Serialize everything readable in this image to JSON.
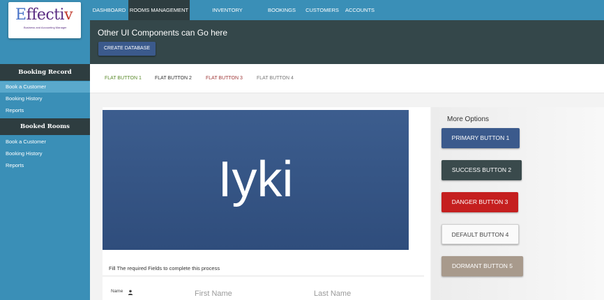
{
  "brand": {
    "logo_first": "E",
    "logo_mid": "ffecti",
    "logo_last": "v",
    "tagline": "Business and Accounting Manager"
  },
  "nav": {
    "items": [
      {
        "label": "DASHBOARD"
      },
      {
        "label": "ROOMS MANAGEMENT"
      },
      {
        "label": "INVENTORY MANAGEMENT"
      },
      {
        "label": "BOOKINGS"
      },
      {
        "label": "CUSTOMERS"
      },
      {
        "label": "ACCOUNTS"
      }
    ],
    "active": "ROOMS MANAGEMENT"
  },
  "header": {
    "title": "Other UI Components can Go here",
    "create_label": "CREATE DATABASE"
  },
  "sidebar": {
    "section1_title": "Booking Record",
    "section1_items": [
      "Book a Customer",
      "Booking History",
      "Reports"
    ],
    "section2_title": "Booked Rooms",
    "section2_items": [
      "Book a Customer",
      "Booking History",
      "Reports"
    ],
    "active_item": "Book a Customer"
  },
  "flat_buttons": [
    {
      "label": "FLAT BUTTON 1",
      "color": "#5a8a2a"
    },
    {
      "label": "FLAT BUTTON 2",
      "color": "#333333"
    },
    {
      "label": "FLAT BUTTON 3",
      "color": "#a03a3a"
    },
    {
      "label": "FLAT BUTTON 4",
      "color": "#777777"
    }
  ],
  "banner": {
    "text": "Iyki"
  },
  "form": {
    "note": "Fill The required Fields to complete this process",
    "name_label": "Name",
    "first_placeholder": "First Name",
    "last_placeholder": "Last Name"
  },
  "options": {
    "title": "More Options",
    "buttons": [
      {
        "label": "PRIMARY BUTTON 1",
        "color": "#3b5a8c"
      },
      {
        "label": "SUCCESS BUTTON 2",
        "color": "#3a4a4c"
      },
      {
        "label": "DANGER BUTTON 3",
        "color": "#c51f1f"
      },
      {
        "label": "DEFAULT BUTTON 4",
        "color": "#fafafa"
      },
      {
        "label": "DORMANT BUTTON 5",
        "color": "#a89a8c"
      }
    ]
  },
  "icons": {
    "name_field": "person-icon"
  }
}
